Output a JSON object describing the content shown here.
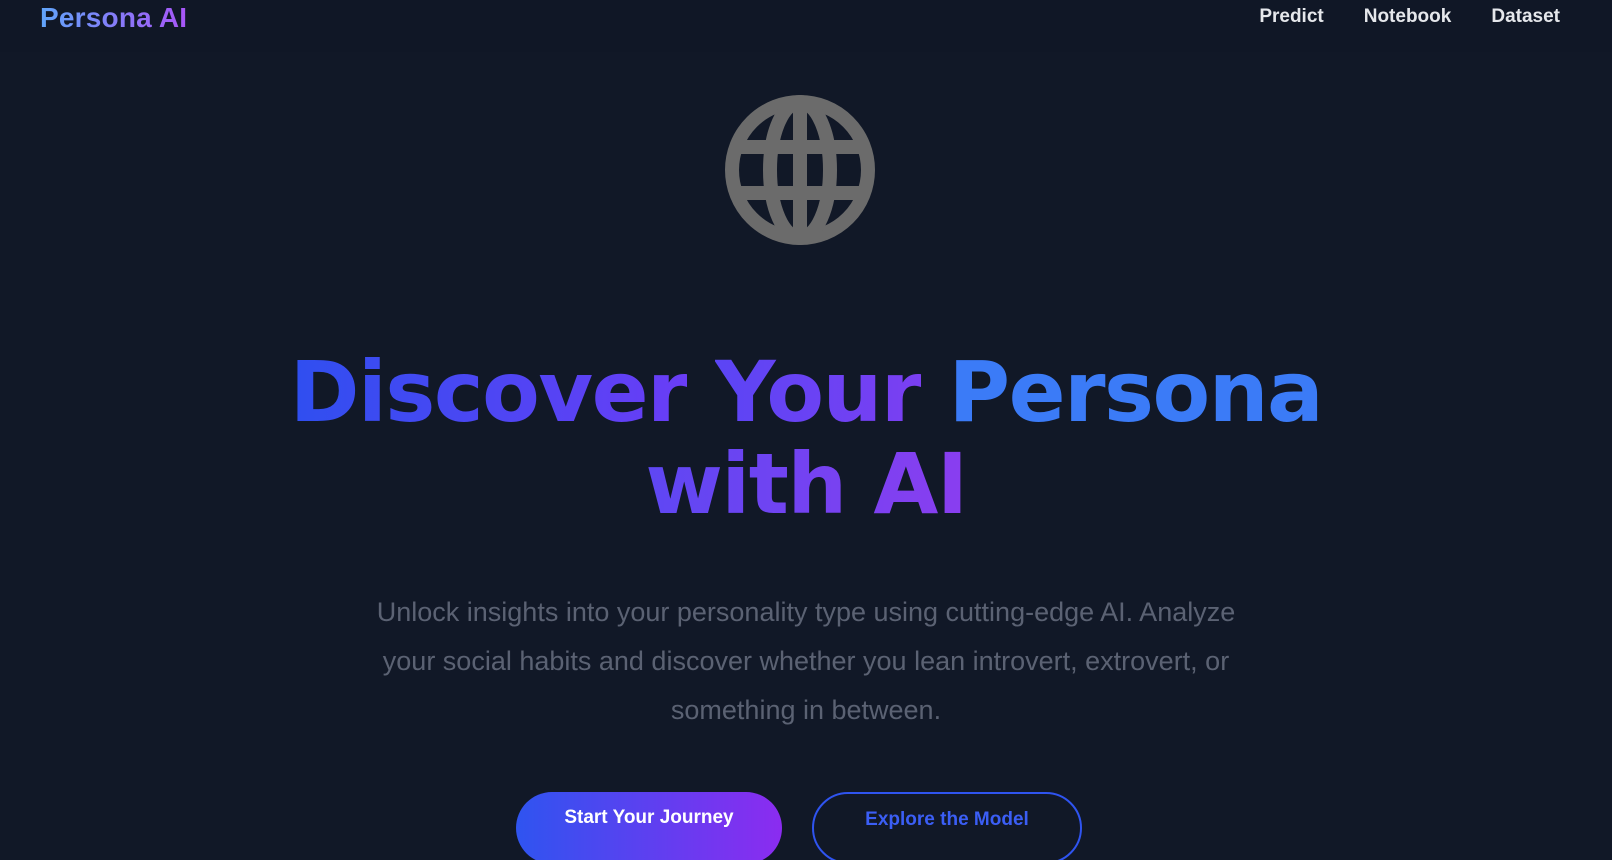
{
  "header": {
    "logo": "Persona AI",
    "nav": [
      "Predict",
      "Notebook",
      "Dataset"
    ]
  },
  "hero": {
    "icon": "globe-icon",
    "headline": {
      "word1": "Discover",
      "word2": "Your",
      "word3": "Persona",
      "line2": "with AI"
    },
    "subtitle": "Unlock insights into your personality type using cutting-edge AI. Analyze your social habits and discover whether you lean introvert, extrovert, or something in between.",
    "primary_button": "Start Your Journey",
    "secondary_button": "Explore the Model"
  },
  "colors": {
    "background": "#111827",
    "accent_blue": "#3b7bf7",
    "accent_purple": "#8b2cf0",
    "globe_gray": "#6b6b6b"
  }
}
